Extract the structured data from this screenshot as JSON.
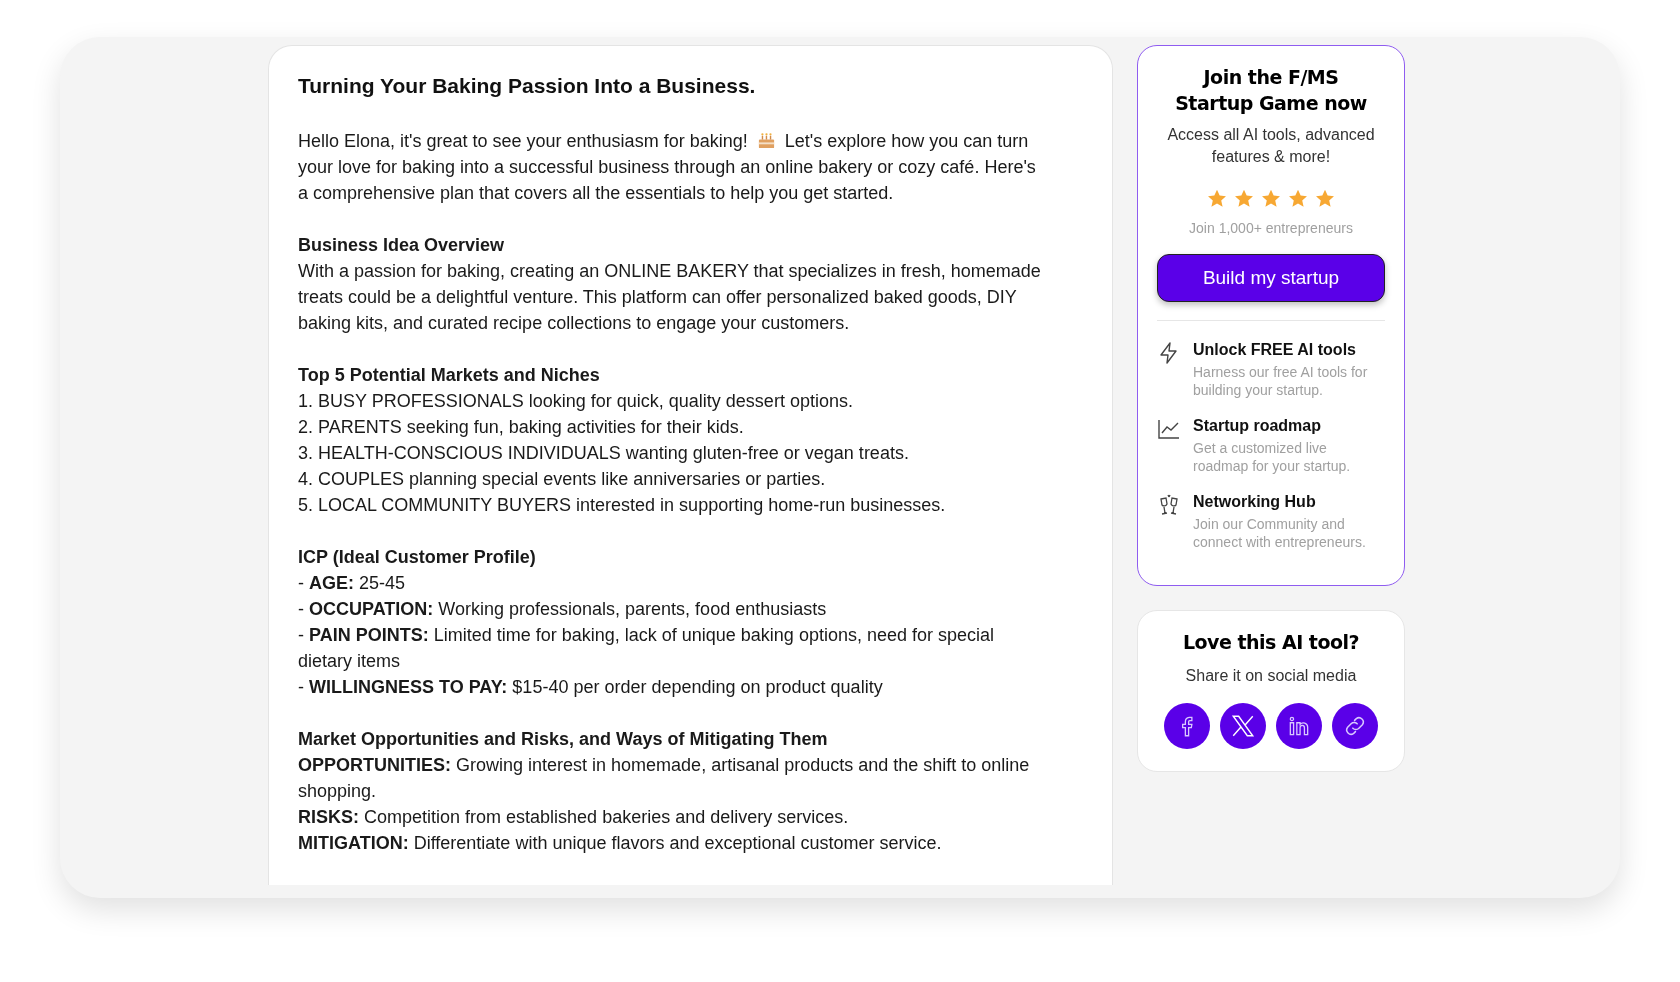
{
  "article": {
    "title": "Turning Your Baking Passion Into a Business.",
    "intro": {
      "before_icon": "Hello Elona, it's great to see your enthusiasm for baking!",
      "after_icon": "Let's explore how you can turn your love for baking into a successful business through an online bakery or cozy café. Here's a comprehensive plan that covers all the essentials to help you get started."
    },
    "sections": [
      {
        "heading": "Business Idea Overview",
        "lines": [
          "With a passion for baking, creating an ONLINE BAKERY that specializes in fresh, homemade treats could be a delightful venture. This platform can offer personalized baked goods, DIY baking kits, and curated recipe collections to engage your customers."
        ]
      },
      {
        "heading": "Top 5 Potential Markets and Niches",
        "lines": [
          "1. BUSY PROFESSIONALS looking for quick, quality dessert options.",
          "2. PARENTS seeking fun, baking activities for their kids.",
          "3. HEALTH-CONSCIOUS INDIVIDUALS wanting gluten-free or vegan treats.",
          "4. COUPLES planning special events like anniversaries or parties.",
          "5. LOCAL COMMUNITY BUYERS interested in supporting home-run businesses."
        ]
      },
      {
        "heading": "ICP (Ideal Customer Profile)",
        "lines": [
          "- **AGE:** 25-45",
          "- **OCCUPATION:** Working professionals, parents, food enthusiasts",
          "- **PAIN POINTS:** Limited time for baking, lack of unique baking options, need for special dietary items",
          "- **WILLINGNESS TO PAY:** $15-40 per order depending on product quality"
        ]
      },
      {
        "heading": "Market Opportunities and Risks, and Ways of Mitigating Them",
        "lines": [
          "**OPPORTUNITIES:** Growing interest in homemade, artisanal products and the shift to online shopping.",
          "**RISKS:** Competition from established bakeries and delivery services.",
          "**MITIGATION:** Differentiate with unique flavors and exceptional customer service."
        ]
      }
    ]
  },
  "promo": {
    "title": "Join the F/MS Startup Game now",
    "subtitle": "Access all AI tools, advanced features & more!",
    "stars": 5,
    "note": "Join 1,000+ entrepreneurs",
    "button": "Build my startup",
    "features": [
      {
        "kind": "bolt",
        "title": "Unlock FREE AI tools",
        "description": "Harness our free AI tools for building your startup."
      },
      {
        "kind": "chart",
        "title": "Startup roadmap",
        "description": "Get a customized live roadmap for your startup."
      },
      {
        "kind": "cheers",
        "title": "Networking Hub",
        "description": "Join our Community and connect with entrepreneurs."
      }
    ]
  },
  "share": {
    "title": "Love this AI tool?",
    "subtitle": "Share it on social media",
    "buttons": [
      {
        "kind": "facebook"
      },
      {
        "kind": "x"
      },
      {
        "kind": "linkedin"
      },
      {
        "kind": "link"
      }
    ]
  }
}
